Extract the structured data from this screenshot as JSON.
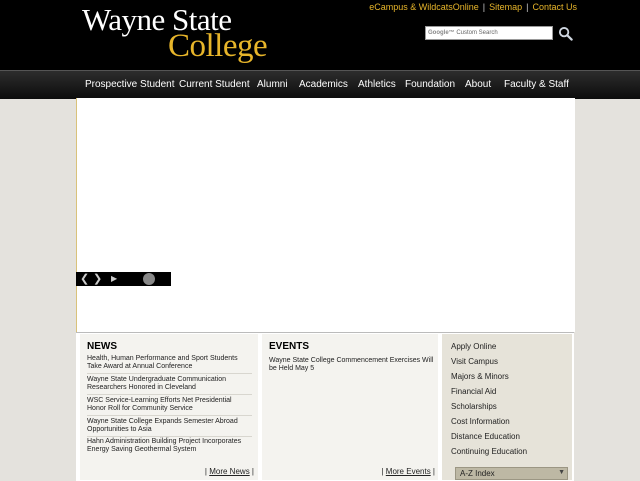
{
  "header": {
    "logo_line1": "Wayne State",
    "logo_line2": "College",
    "top_links": [
      "eCampus & WildcatsOnline",
      "Sitemap",
      "Contact Us"
    ],
    "separator": "|",
    "search": {
      "brand": "Google™",
      "placeholder": "Custom Search"
    },
    "search_icon": "magnifier-icon",
    "colors": {
      "background": "#000000",
      "accent": "#e7b52a"
    }
  },
  "nav": {
    "items": [
      "Prospective Student",
      "Current Student",
      "Alumni",
      "Academics",
      "Athletics",
      "Foundation",
      "About",
      "Faculty & Staff"
    ]
  },
  "slider": {
    "controls": {
      "prev": "❮",
      "next": "❯",
      "play": "▶",
      "indicator": "●"
    }
  },
  "news": {
    "title": "NEWS",
    "items": [
      "Health, Human Performance and Sport Students Take Award at Annual Conference",
      "Wayne State Undergraduate Communication Researchers Honored in Cleveland",
      "WSC Service-Learning Efforts Net Presidential Honor Roll for Community Service",
      "Wayne State College Expands Semester Abroad Opportunities to Asia",
      "Hahn Administration Building Project Incorporates Energy Saving Geothermal System"
    ],
    "more_label": "More News"
  },
  "events": {
    "title": "EVENTS",
    "items": [
      "Wayne State College Commencement Exercises Will be Held May 5"
    ],
    "more_label": "More Events"
  },
  "quick_links": {
    "items": [
      "Apply Online",
      "Visit Campus",
      "Majors & Minors",
      "Financial Aid",
      "Scholarships",
      "Cost Information",
      "Distance Education",
      "Continuing Education"
    ],
    "az_label": "A-Z Index",
    "az_arrow": "▼"
  }
}
